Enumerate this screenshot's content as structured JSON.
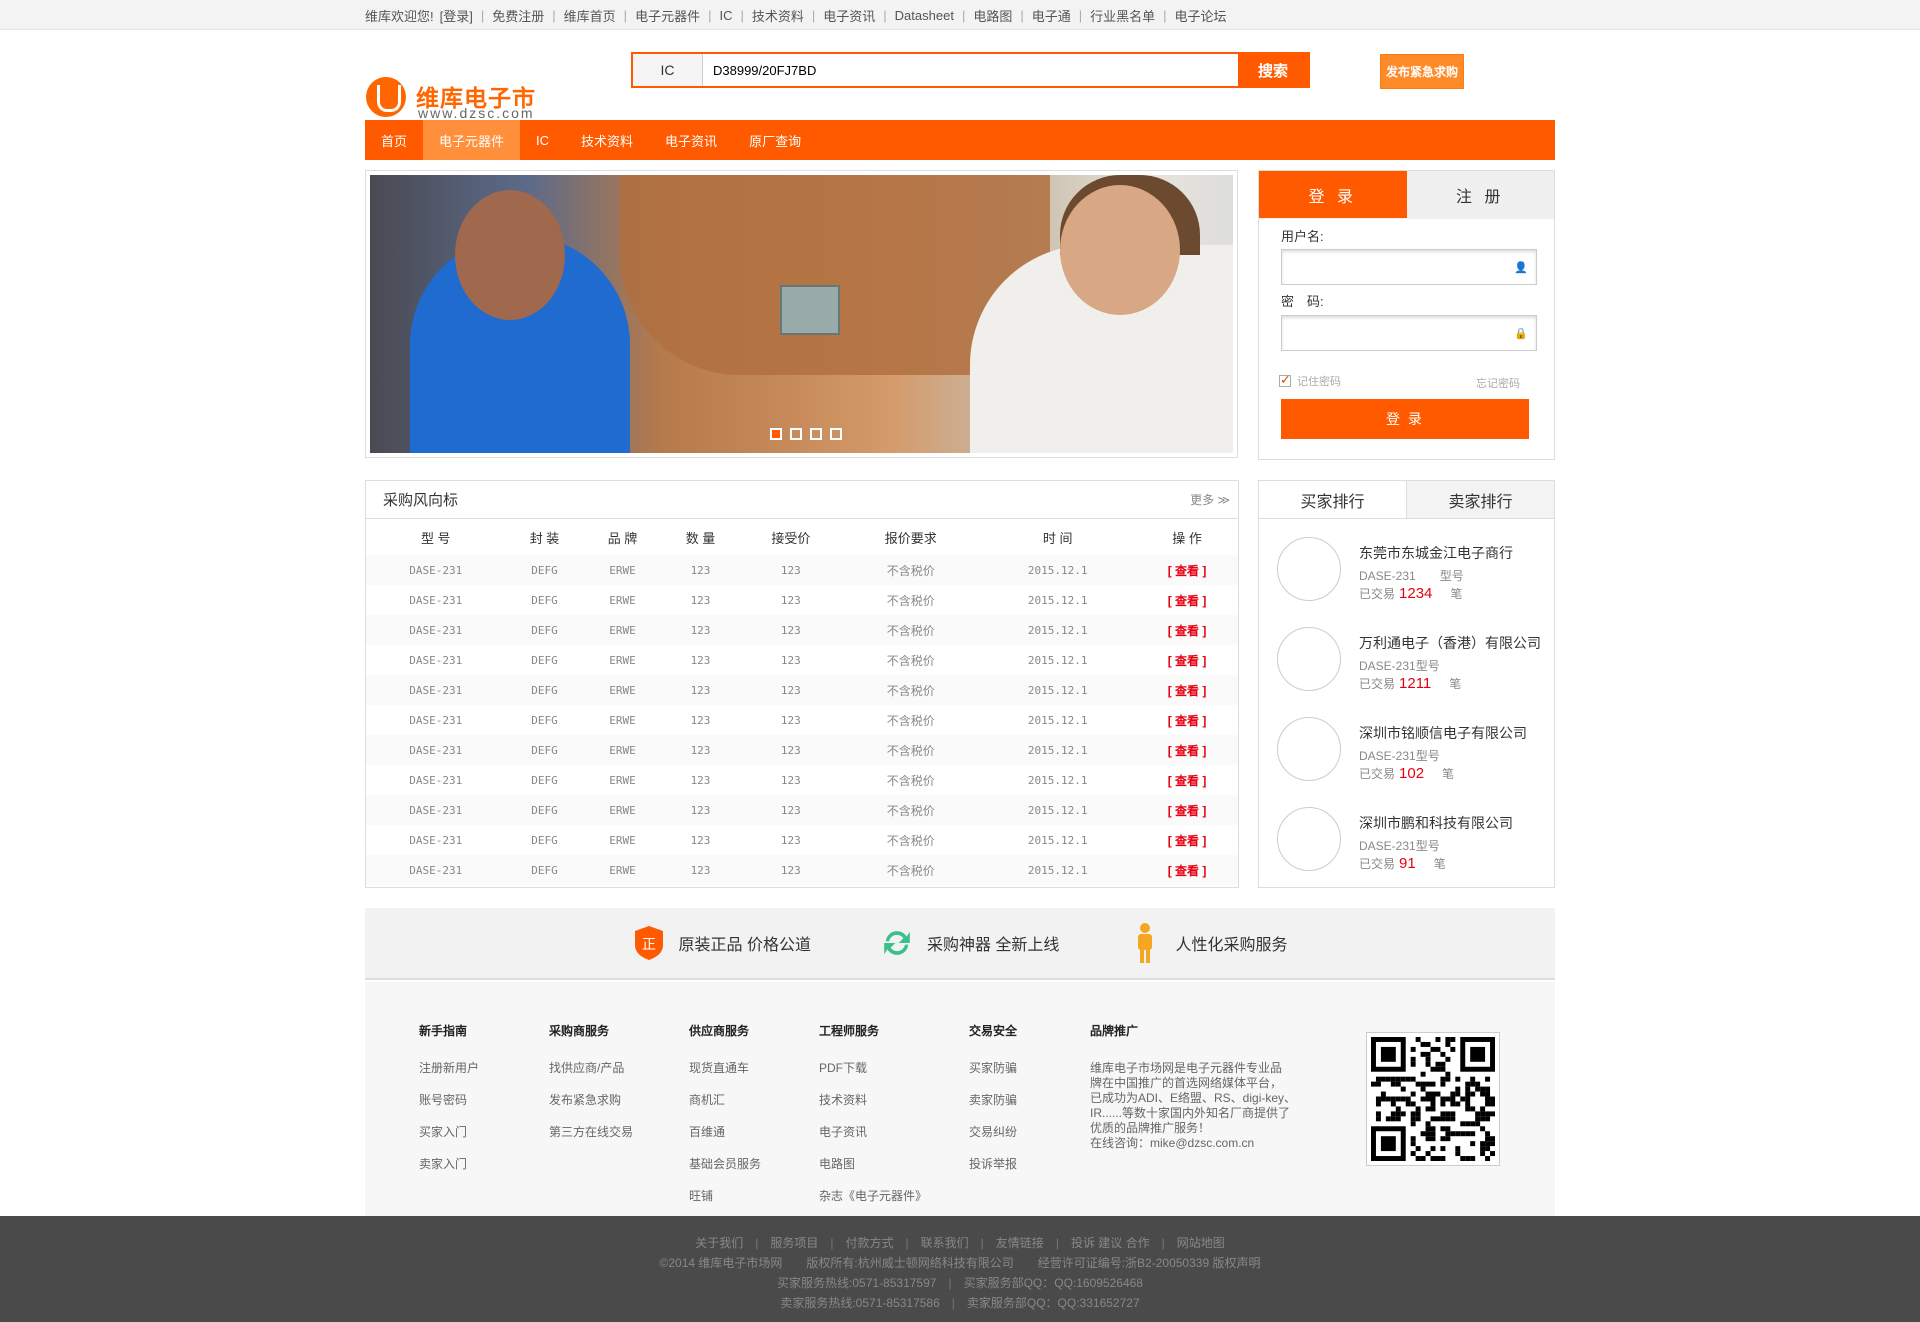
{
  "topbar": {
    "links": [
      "维库欢迎您!",
      "[登录]",
      "免费注册",
      "维库首页",
      "电子元器件",
      "IC",
      "技术资料",
      "电子资讯",
      "Datasheet",
      "电路图",
      "电子通",
      "行业黑名单",
      "电子论坛"
    ]
  },
  "logo": {
    "name": "维库电子市场",
    "url": "www.dzsc.com"
  },
  "search": {
    "category": "IC",
    "value": "D38999/20FJ7BD",
    "button": "搜索"
  },
  "urgent_button": "发布紧急求购",
  "nav": {
    "items": [
      "首页",
      "电子元器件",
      "IC",
      "技术资料",
      "电子资讯",
      "原厂查询"
    ],
    "active": 1
  },
  "banner": {
    "slides": 4,
    "active": 0
  },
  "login": {
    "tab_login": "登 录",
    "tab_register": "注 册",
    "username_label": "用户名:",
    "password_label": "密　码:",
    "remember": "记住密码",
    "forgot": "忘记密码",
    "submit": "登 录"
  },
  "purchase": {
    "title": "采购风向标",
    "more": "更多",
    "columns": [
      "型 号",
      "封 装",
      "品 牌",
      "数 量",
      "接受价",
      "报价要求",
      "时 间",
      "操 作"
    ],
    "rows": [
      [
        "DASE-231",
        "DEFG",
        "ERWE",
        "123",
        "123",
        "不含税价",
        "2015.12.1",
        "[ 查看 ]"
      ],
      [
        "DASE-231",
        "DEFG",
        "ERWE",
        "123",
        "123",
        "不含税价",
        "2015.12.1",
        "[ 查看 ]"
      ],
      [
        "DASE-231",
        "DEFG",
        "ERWE",
        "123",
        "123",
        "不含税价",
        "2015.12.1",
        "[ 查看 ]"
      ],
      [
        "DASE-231",
        "DEFG",
        "ERWE",
        "123",
        "123",
        "不含税价",
        "2015.12.1",
        "[ 查看 ]"
      ],
      [
        "DASE-231",
        "DEFG",
        "ERWE",
        "123",
        "123",
        "不含税价",
        "2015.12.1",
        "[ 查看 ]"
      ],
      [
        "DASE-231",
        "DEFG",
        "ERWE",
        "123",
        "123",
        "不含税价",
        "2015.12.1",
        "[ 查看 ]"
      ],
      [
        "DASE-231",
        "DEFG",
        "ERWE",
        "123",
        "123",
        "不含税价",
        "2015.12.1",
        "[ 查看 ]"
      ],
      [
        "DASE-231",
        "DEFG",
        "ERWE",
        "123",
        "123",
        "不含税价",
        "2015.12.1",
        "[ 查看 ]"
      ],
      [
        "DASE-231",
        "DEFG",
        "ERWE",
        "123",
        "123",
        "不含税价",
        "2015.12.1",
        "[ 查看 ]"
      ],
      [
        "DASE-231",
        "DEFG",
        "ERWE",
        "123",
        "123",
        "不含税价",
        "2015.12.1",
        "[ 查看 ]"
      ],
      [
        "DASE-231",
        "DEFG",
        "ERWE",
        "123",
        "123",
        "不含税价",
        "2015.12.1",
        "[ 查看 ]"
      ]
    ]
  },
  "ranking": {
    "tab_buyer": "买家排行",
    "tab_seller": "卖家排行",
    "items": [
      {
        "name": "东莞市东城金江电子商行",
        "model": "DASE-231　　型号",
        "deal_prefix": "已交易",
        "count": "1234",
        "unit": "笔"
      },
      {
        "name": "万利通电子（香港）有限公司",
        "model": "DASE-231型号",
        "deal_prefix": "已交易",
        "count": "1211",
        "unit": "笔"
      },
      {
        "name": "深圳市铭顺信电子有限公司",
        "model": "DASE-231型号",
        "deal_prefix": "已交易",
        "count": "102",
        "unit": "笔"
      },
      {
        "name": "深圳市鹏和科技有限公司",
        "model": "DASE-231型号",
        "deal_prefix": "已交易",
        "count": "91",
        "unit": "笔"
      }
    ]
  },
  "features": [
    {
      "icon": "shield-icon",
      "badge": "正",
      "text": "原装正品 价格公道"
    },
    {
      "icon": "refresh-icon",
      "text": "采购神器 全新上线"
    },
    {
      "icon": "person-icon",
      "text": "人性化采购服务"
    }
  ],
  "footer": {
    "columns": [
      {
        "title": "新手指南",
        "links": [
          "注册新用户",
          "账号密码",
          "买家入门",
          "卖家入门"
        ]
      },
      {
        "title": "采购商服务",
        "links": [
          "找供应商/产品",
          "发布紧急求购",
          "第三方在线交易"
        ]
      },
      {
        "title": "供应商服务",
        "links": [
          "现货直通车",
          "商机汇",
          "百维通",
          "基础会员服务",
          "旺铺"
        ]
      },
      {
        "title": "工程师服务",
        "links": [
          "PDF下载",
          "技术资料",
          "电子资讯",
          "电路图",
          "杂志《电子元器件》"
        ]
      },
      {
        "title": "交易安全",
        "links": [
          "买家防骗",
          "卖家防骗",
          "交易纠纷",
          "投诉举报"
        ]
      }
    ],
    "brand": {
      "title": "品牌推广",
      "lines": [
        "维库电子市场网是电子元器件专业品",
        "牌在中国推广的首选网络媒体平台，",
        "已成功为ADI、E络盟、RS、digi-key、",
        "IR......等数十家国内外知名厂商提供了",
        "优质的品牌推广服务！",
        "在线咨询：mike@dzsc.com.cn"
      ]
    }
  },
  "bottom": {
    "links": [
      "关于我们",
      "服务项目",
      "付款方式",
      "联系我们",
      "友情链接",
      "投诉 建议 合作",
      "网站地图"
    ],
    "copyright": "©2014 维库电子市场网　　版权所有:杭州威士顿网络科技有限公司　　经营许可证编号:浙B2-20050339 版权声明",
    "line3": [
      "买家服务热线:0571-85317597",
      "买家服务部QQ：QQ:1609526468"
    ],
    "line4": [
      "卖家服务热线:0571-85317586",
      "卖家服务部QQ：QQ:331652727"
    ]
  }
}
